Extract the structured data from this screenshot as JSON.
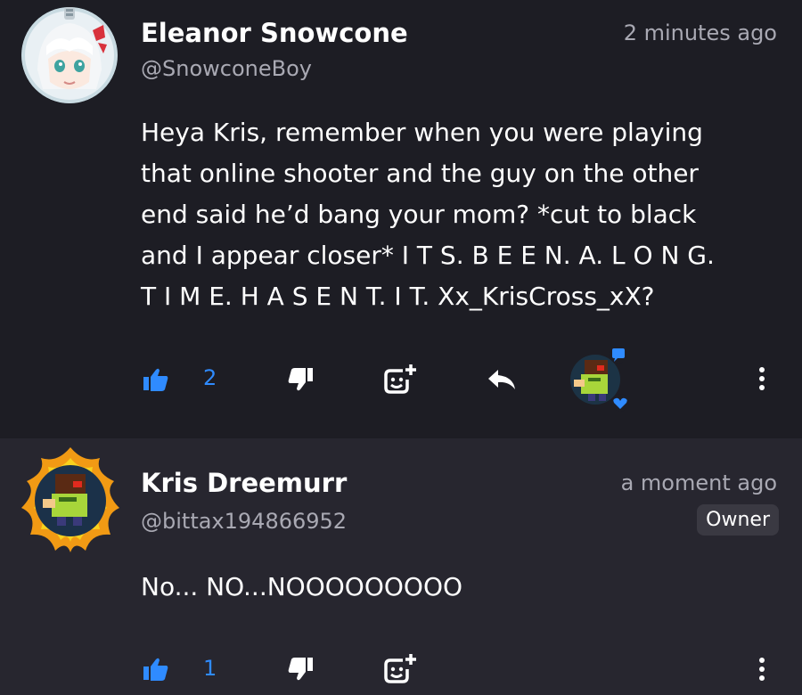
{
  "comments": [
    {
      "author": "Eleanor Snowcone",
      "handle": "@SnowconeBoy",
      "time": "2 minutes ago",
      "lines": [
        "Heya Kris, remember when you were playing",
        "that online shooter and the guy on the other",
        "end said he’d bang your mom? *cut to black",
        "and I appear closer* I T S. B E E N.  A. L O N G.",
        "T I M E.  H A S E N T.  I T. Xx_KrisCross_xX?"
      ],
      "likes": "2",
      "avatar_icon": "anime-girl-avatar"
    },
    {
      "author": "Kris Dreemurr",
      "handle": "@bittax194866952",
      "time": "a moment ago",
      "badge": "Owner",
      "lines": [
        "No... NO...NOOOOOOOOO"
      ],
      "likes": "1",
      "avatar_icon": "pixel-kris-flame-avatar"
    }
  ],
  "colors": {
    "accent": "#2f8bff",
    "muted": "#a9a9b3",
    "bg1": "#1d1d24",
    "bg2": "#27262f"
  }
}
